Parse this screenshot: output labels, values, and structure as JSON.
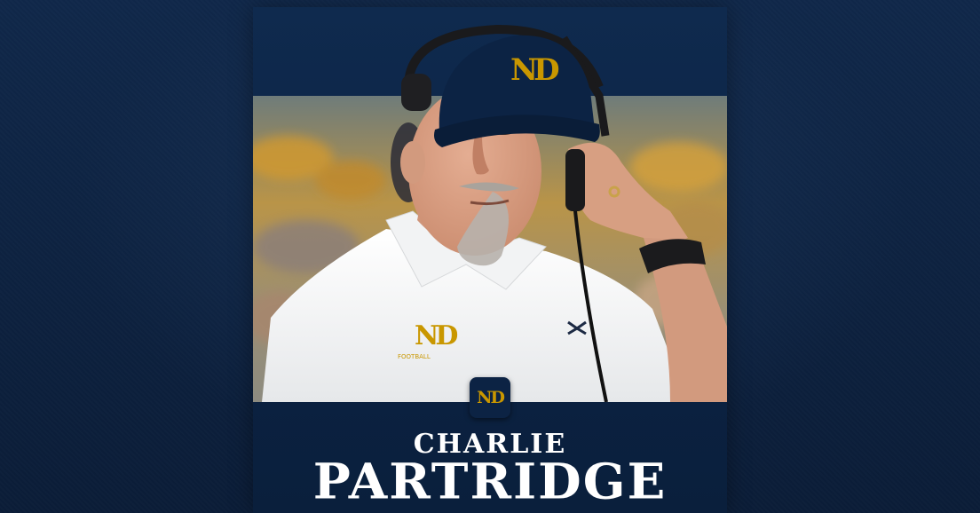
{
  "graphic": {
    "logo_text": "ND",
    "shirt_logo_text": "ND",
    "shirt_logo_caption": "FOOTBALL",
    "first_name": "CHARLIE",
    "last_name": "PARTRIDGE"
  },
  "colors": {
    "navy": "#0c2344",
    "gold": "#c99700",
    "white": "#ffffff"
  }
}
